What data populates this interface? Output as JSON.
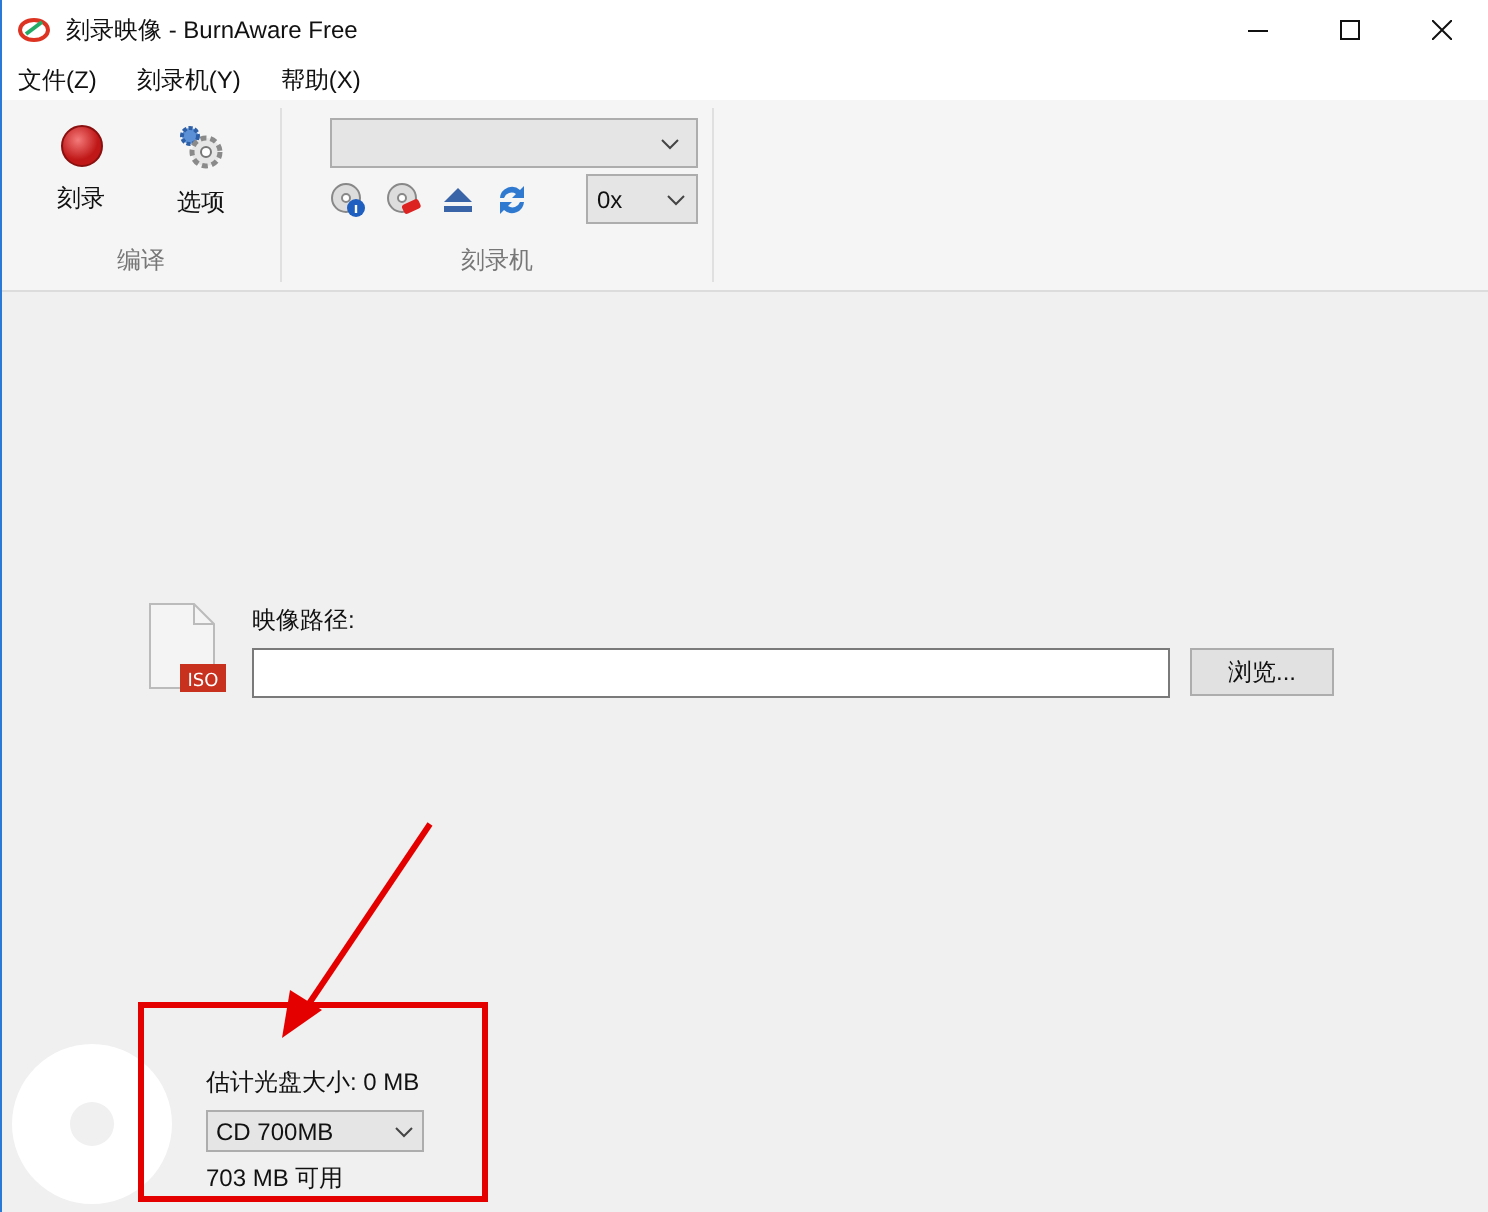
{
  "window": {
    "title": "刻录映像 - BurnAware Free"
  },
  "menu": [
    "文件(Z)",
    "刻录机(Y)",
    "帮助(X)"
  ],
  "ribbon": {
    "groups": [
      {
        "label": "编译",
        "buttons": [
          {
            "kind": "burn",
            "label": "刻录"
          },
          {
            "kind": "options",
            "label": "选项"
          }
        ]
      },
      {
        "label": "刻录机",
        "speed": "0x"
      }
    ]
  },
  "image_path": {
    "label": "映像路径:",
    "browse": "浏览...",
    "file_badge": "ISO"
  },
  "disc": {
    "estimate": "估计光盘大小: 0 MB",
    "type": "CD 700MB",
    "free": "703 MB 可用"
  }
}
